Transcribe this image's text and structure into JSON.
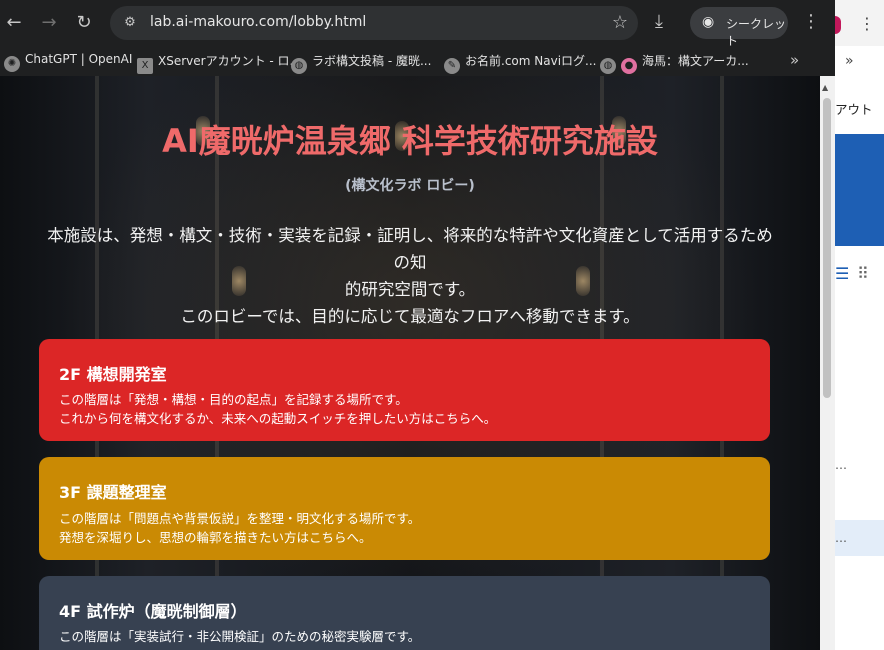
{
  "toolbar": {
    "back_icon": "←",
    "forward_icon": "→",
    "reload_icon": "↻",
    "url": "lab.ai-makouro.com/lobby.html",
    "incognito_label": "シークレット"
  },
  "bookmarks": [
    {
      "label": "ChatGPT | OpenAI",
      "icon": "chatgpt-icon"
    },
    {
      "label": "XServerアカウント - ロ...",
      "icon": "xserver-icon"
    },
    {
      "label": "ラボ構文投稿 - 魔晄...",
      "icon": "globe-icon"
    },
    {
      "label": "お名前.com Naviログ...",
      "icon": "onamae-icon"
    },
    {
      "label": "海馬：構文アーカ...",
      "icon": "brain-icon"
    }
  ],
  "page": {
    "title": "AI魔晄炉温泉郷 科学技術研究施設",
    "subtitle": "(構文化ラボ ロビー)",
    "intro": [
      "本施設は、発想・構文・技術・実装を記録・証明し、将来的な特許や文化資産として活用するための知",
      "的研究空間です。",
      "このロビーでは、目的に応じて最適なフロアへ移動できます。"
    ],
    "floors": [
      {
        "title": "2F 構想開発室",
        "lines": [
          "この階層は「発想・構想・目的の起点」を記録する場所です。",
          "これから何を構文化するか、未来への起動スイッチを押したい方はこちらへ。"
        ],
        "color": "#dc2626"
      },
      {
        "title": "3F 課題整理室",
        "lines": [
          "この階層は「問題点や背景仮説」を整理・明文化する場所です。",
          "発想を深堀りし、思想の輪郭を描きたい方はこちらへ。"
        ],
        "color": "#ca8a04"
      },
      {
        "title": "4F 試作炉（魔晄制御層）",
        "lines": [
          "この階層は「実装試行・非公開検証」のための秘密実験層です。"
        ],
        "color": "#374151"
      }
    ]
  },
  "background_window": {
    "text": "アウト"
  },
  "colors": {
    "title": "#ef6a6a",
    "chrome": "#1f2021"
  }
}
